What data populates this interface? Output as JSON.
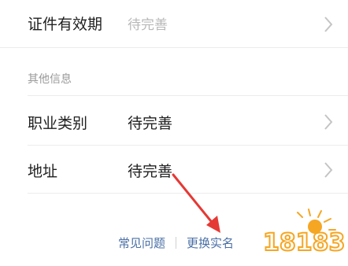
{
  "rows": {
    "validity": {
      "label": "证件有效期",
      "value": "待完善",
      "value_state": "placeholder"
    },
    "occupation": {
      "label": "职业类别",
      "value": "待完善"
    },
    "address": {
      "label": "地址",
      "value": "待完善"
    }
  },
  "section_other": {
    "title": "其他信息"
  },
  "footer": {
    "faq_label": "常见问题",
    "change_name_label": "更换实名"
  },
  "icons": {
    "chevron": "chevron-right-icon",
    "annotation": "red-arrow-annotation",
    "watermark": "site-watermark-logo"
  },
  "colors": {
    "primary_text": "#1f1f1f",
    "placeholder_text": "#b8b8b8",
    "section_title": "#9a9a9a",
    "link": "#4a6fa5",
    "annotation_arrow": "#e53935",
    "watermark_orange": "#f5a623"
  },
  "watermark": {
    "text": "18183"
  }
}
